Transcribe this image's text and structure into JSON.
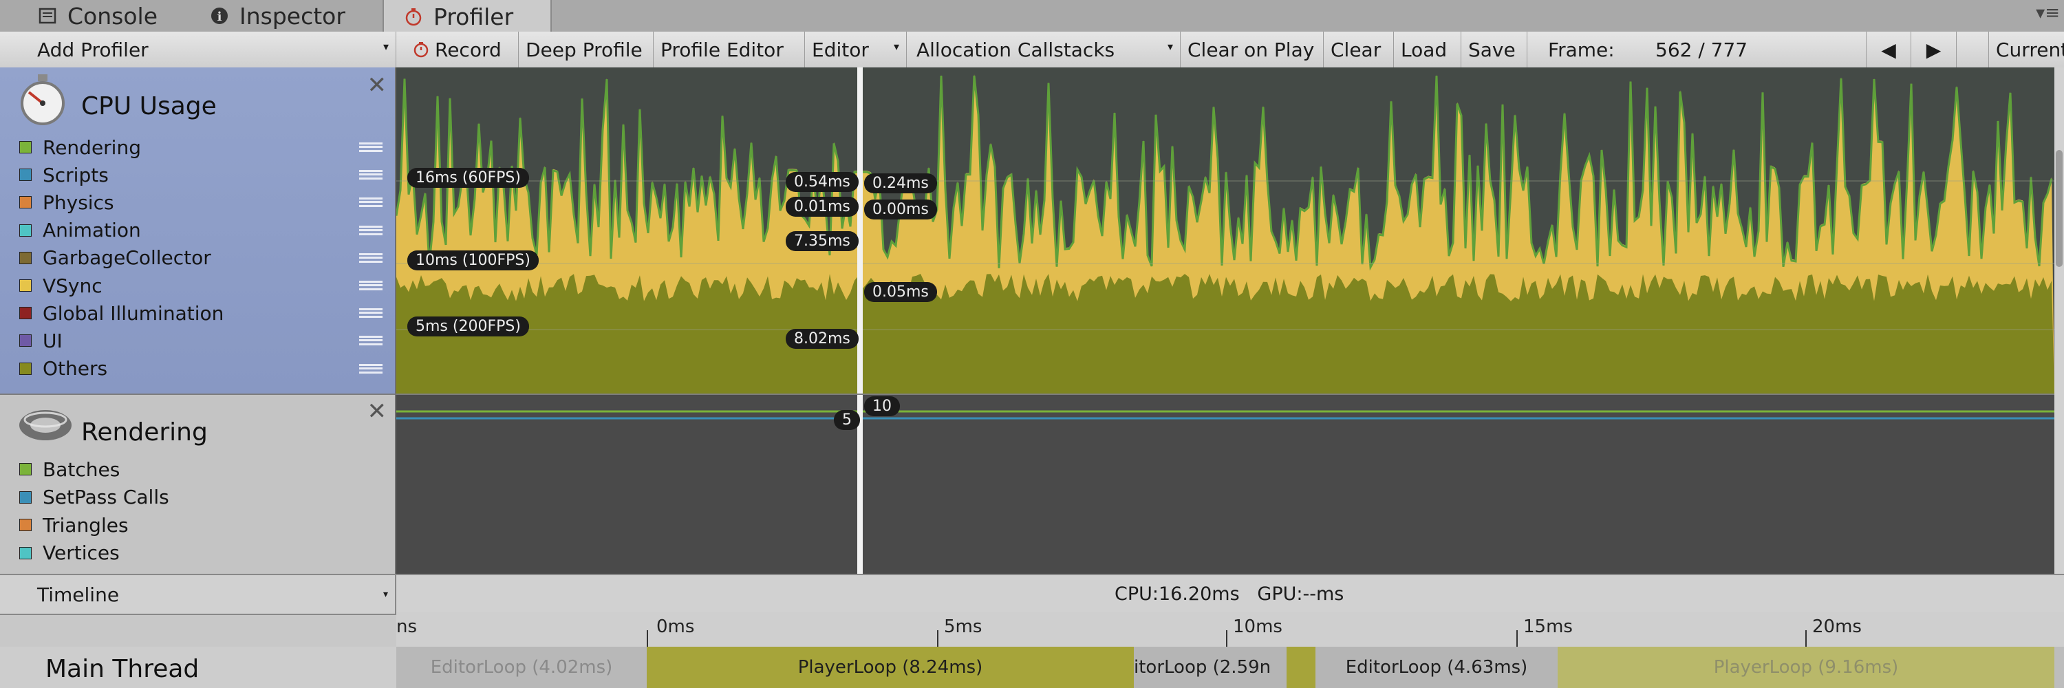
{
  "tabs": [
    {
      "label": "Console",
      "icon": "console-icon"
    },
    {
      "label": "Inspector",
      "icon": "info-icon"
    },
    {
      "label": "Profiler",
      "icon": "stopwatch-icon"
    }
  ],
  "toolbar": {
    "add_profiler": "Add Profiler",
    "record": "Record",
    "deep_profile": "Deep Profile",
    "profile_editor": "Profile Editor",
    "editor": "Editor",
    "allocation_callstacks": "Allocation Callstacks",
    "clear_on_play": "Clear on Play",
    "clear": "Clear",
    "load": "Load",
    "save": "Save",
    "frame_label": "Frame:",
    "frame_value": "562 / 777",
    "current": "Current"
  },
  "cpu_panel": {
    "title": "CPU Usage",
    "legend": [
      {
        "label": "Rendering",
        "color": "#7bb33a"
      },
      {
        "label": "Scripts",
        "color": "#3a8fb7"
      },
      {
        "label": "Physics",
        "color": "#d9823b"
      },
      {
        "label": "Animation",
        "color": "#4fc4c4"
      },
      {
        "label": "GarbageCollector",
        "color": "#7d6a33"
      },
      {
        "label": "VSync",
        "color": "#e6c449"
      },
      {
        "label": "Global Illumination",
        "color": "#8e2222"
      },
      {
        "label": "UI",
        "color": "#6f5aa6"
      },
      {
        "label": "Others",
        "color": "#868a1f"
      }
    ],
    "fps_labels": [
      "16ms (60FPS)",
      "10ms (100FPS)",
      "5ms (200FPS)"
    ],
    "left_values": [
      "0.54ms",
      "0.01ms",
      "7.35ms",
      "8.02ms"
    ],
    "right_values": [
      "0.24ms",
      "0.00ms",
      "0.05ms"
    ]
  },
  "rendering_panel": {
    "title": "Rendering",
    "legend": [
      {
        "label": "Batches",
        "color": "#7bb33a"
      },
      {
        "label": "SetPass Calls",
        "color": "#3a8fb7"
      },
      {
        "label": "Triangles",
        "color": "#d9823b"
      },
      {
        "label": "Vertices",
        "color": "#4fc4c4"
      }
    ],
    "value_left": "5",
    "value_right": "10"
  },
  "timeline": {
    "mode": "Timeline",
    "cpu_gpu": "CPU:16.20ms   GPU:--ms",
    "ruler": [
      "ns",
      "0ms",
      "5ms",
      "10ms",
      "15ms",
      "20ms"
    ],
    "thread": "Main Thread",
    "bars": [
      {
        "label": "EditorLoop (4.02ms)"
      },
      {
        "label": "PlayerLoop (8.24ms)"
      },
      {
        "label": "itorLoop (2.59n"
      },
      {
        "label": "EditorLoop (4.63ms)"
      },
      {
        "label": "PlayerLoop (9.16ms)"
      }
    ]
  }
}
